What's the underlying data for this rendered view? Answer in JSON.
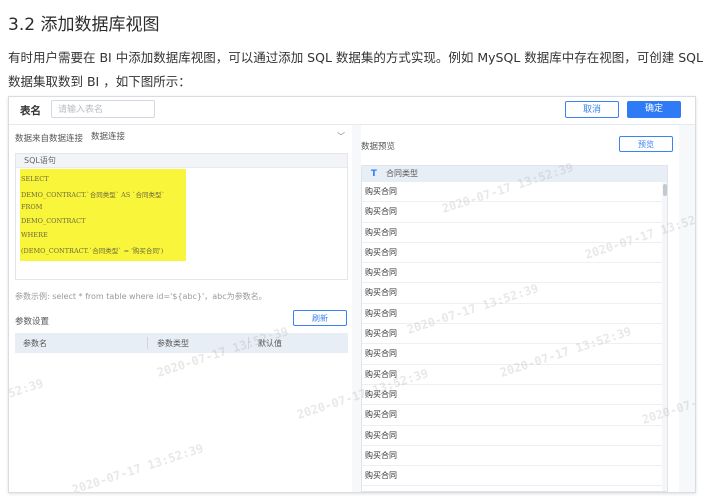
{
  "heading": "3.2 添加数据库视图",
  "paragraph": "有时用户需要在 BI 中添加数据库视图，可以通过添加 SQL 数据集的方式实现。例如 MySQL 数据库中存在视图，可创建 SQL 数据集取数到 BI ，如下图所示：",
  "topbar": {
    "table_name_label": "表名",
    "table_name_placeholder": "请输入表名",
    "cancel_label": "取消",
    "confirm_label": "确定"
  },
  "left": {
    "datasource_label": "数据来自数据连接",
    "datasource_value": "数据连接",
    "sql_header": "SQL语句",
    "sql_lines": [
      "SELECT",
      "DEMO_CONTRACT.`合同类型` AS `合同类型`",
      "FROM",
      "DEMO_CONTRACT",
      "WHERE",
      "(DEMO_CONTRACT.`合同类型` = '购买合同')"
    ],
    "param_example": "参数示例:  select * from table where id='${abc}'，abc为参数名。",
    "param_settings_label": "参数设置",
    "refresh_label": "刷新",
    "param_columns": [
      "参数名",
      "参数类型",
      "默认值"
    ]
  },
  "right": {
    "preview_title": "数据预览",
    "preview_button": "预览",
    "column_type_icon": "T",
    "column_header": "合同类型",
    "rows": [
      "购买合同",
      "购买合同",
      "购买合同",
      "购买合同",
      "购买合同",
      "购买合同",
      "购买合同",
      "购买合同",
      "购买合同",
      "购买合同",
      "购买合同",
      "购买合同",
      "购买合同",
      "购买合同",
      "购买合同"
    ]
  },
  "watermark": "2020-07-17 13:52:39",
  "colors": {
    "accent": "#2f7bf5",
    "highlight": "#f9f53a"
  }
}
